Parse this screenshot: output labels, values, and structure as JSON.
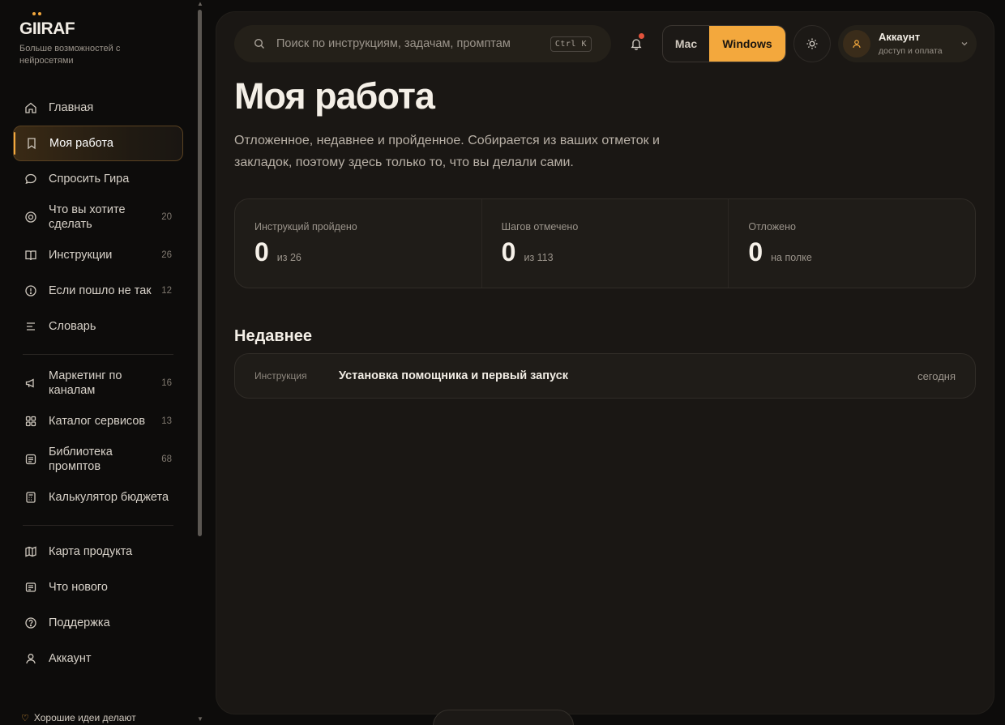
{
  "brand": {
    "logo_text": "GIIRAF",
    "tagline": "Больше возможностей с нейросетями"
  },
  "sidebar": {
    "items": [
      {
        "label": "Главная",
        "count": "",
        "icon": "home-icon"
      },
      {
        "label": "Моя работа",
        "count": "",
        "icon": "bookmark-icon",
        "active": true
      },
      {
        "label": "Спросить Гира",
        "count": "",
        "icon": "chat-icon"
      },
      {
        "label": "Что вы хотите сделать",
        "count": "20",
        "icon": "target-icon"
      },
      {
        "label": "Инструкции",
        "count": "26",
        "icon": "book-icon"
      },
      {
        "label": "Если пошло не так",
        "count": "12",
        "icon": "alert-icon"
      },
      {
        "label": "Словарь",
        "count": "",
        "icon": "list-icon"
      }
    ],
    "items2": [
      {
        "label": "Маркетинг по каналам",
        "count": "16",
        "icon": "megaphone-icon"
      },
      {
        "label": "Каталог сервисов",
        "count": "13",
        "icon": "grid-icon"
      },
      {
        "label": "Библиотека промптов",
        "count": "68",
        "icon": "document-icon"
      },
      {
        "label": "Калькулятор бюджета",
        "count": "",
        "icon": "calculator-icon"
      }
    ],
    "items3": [
      {
        "label": "Карта продукта",
        "icon": "map-icon"
      },
      {
        "label": "Что нового",
        "icon": "news-icon"
      },
      {
        "label": "Поддержка",
        "icon": "help-icon"
      },
      {
        "label": "Аккаунт",
        "icon": "user-icon"
      }
    ],
    "footer_text": "Хорошие идеи делают"
  },
  "header": {
    "search_placeholder": "Поиск по инструкциям, задачам, промптам",
    "search_shortcut": "Ctrl K",
    "os_mac": "Mac",
    "os_windows": "Windows",
    "os_selected": "Windows",
    "account_title": "Аккаунт",
    "account_sub": "доступ и оплата"
  },
  "page": {
    "title": "Моя работа",
    "description": "Отложенное, недавнее и пройденное. Собирается из ваших отметок и закладок, поэтому здесь только то, что вы делали сами."
  },
  "stats": [
    {
      "label": "Инструкций пройдено",
      "value": "0",
      "sub": "из 26"
    },
    {
      "label": "Шагов отмечено",
      "value": "0",
      "sub": "из 113"
    },
    {
      "label": "Отложено",
      "value": "0",
      "sub": "на полке"
    }
  ],
  "recent": {
    "title": "Недавнее",
    "rows": [
      {
        "kind": "Инструкция",
        "name": "Установка помощника и первый запуск",
        "when": "сегодня"
      }
    ]
  },
  "colors": {
    "accent": "#f3a83d",
    "background": "#0d0c0b",
    "panel": "#1a1714",
    "notification_dot": "#e2533c"
  }
}
